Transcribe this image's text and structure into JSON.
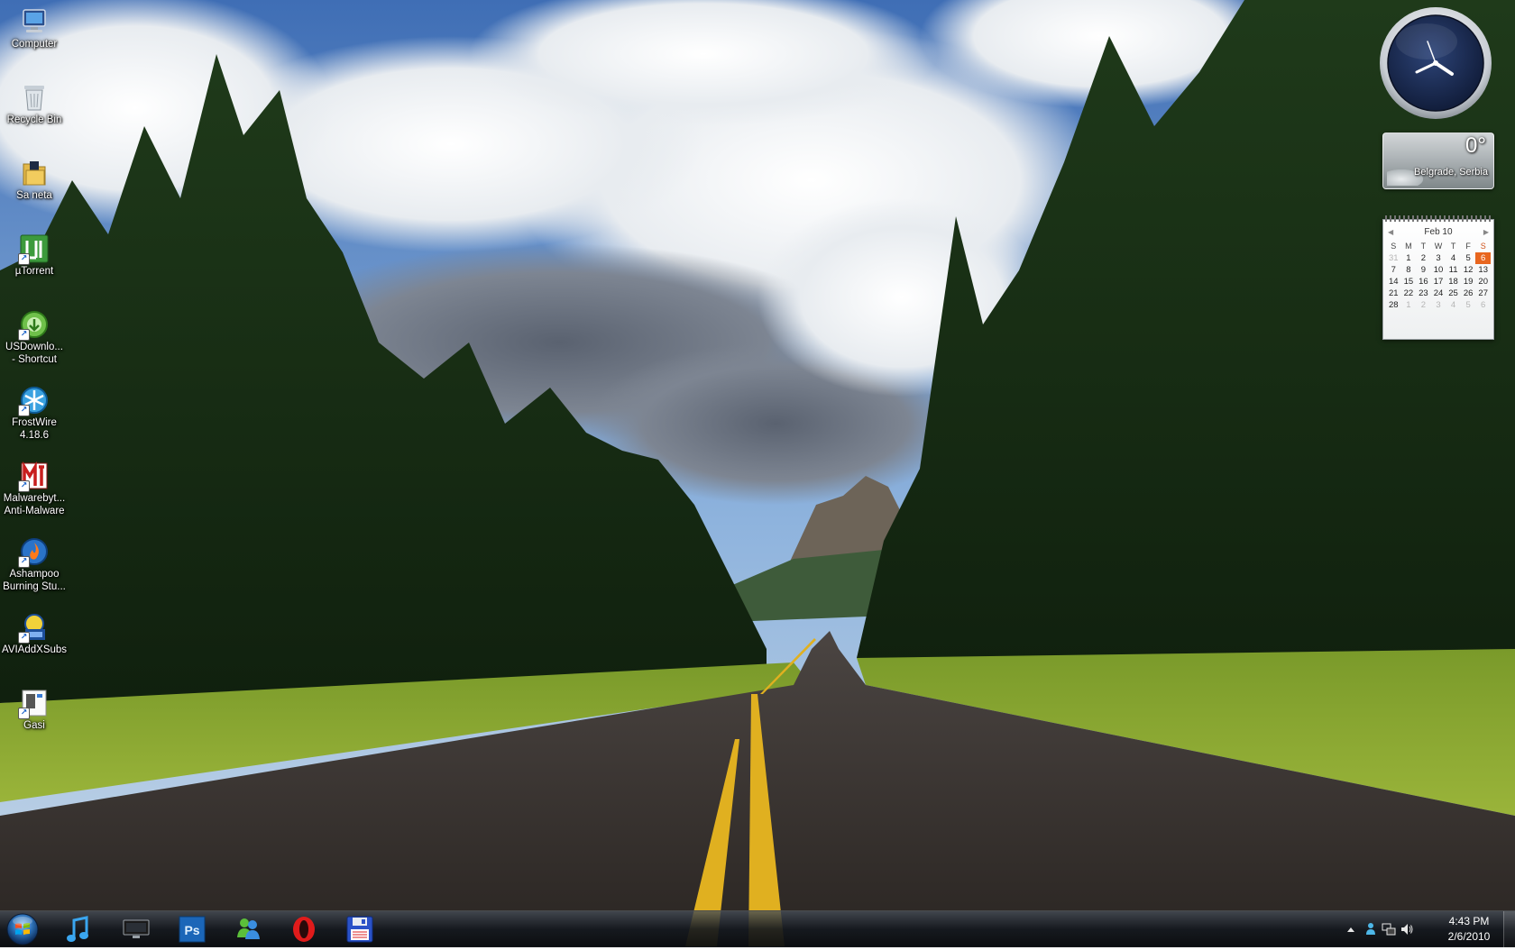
{
  "desktop": {
    "icons": [
      {
        "label": "Computer",
        "icon": "computer-icon"
      },
      {
        "label": "Recycle Bin",
        "icon": "recycle-bin-icon"
      },
      {
        "label": "Sa neta",
        "icon": "folder-icon"
      },
      {
        "label": "µTorrent",
        "icon": "utorrent-icon"
      },
      {
        "label": "USDownlo...\n- Shortcut",
        "icon": "usdownloader-icon"
      },
      {
        "label": "FrostWire\n4.18.6",
        "icon": "frostwire-icon"
      },
      {
        "label": "Malwarebyt...\nAnti-Malware",
        "icon": "malwarebytes-icon"
      },
      {
        "label": "Ashampoo\nBurning Stu...",
        "icon": "ashampoo-icon"
      },
      {
        "label": "AVIAddXSubs",
        "icon": "aviaddxsubs-icon"
      },
      {
        "label": "Gasi",
        "icon": "shutdown-shortcut-icon"
      }
    ]
  },
  "gadgets": {
    "clock": {
      "time": "4:43"
    },
    "weather": {
      "temperature": "0°",
      "location": "Belgrade, Serbia"
    },
    "calendar": {
      "month": "Feb 10",
      "weekdays": [
        "S",
        "M",
        "T",
        "W",
        "T",
        "F",
        "S"
      ],
      "days": [
        "31",
        "1",
        "2",
        "3",
        "4",
        "5",
        "6",
        "7",
        "8",
        "9",
        "10",
        "11",
        "12",
        "13",
        "14",
        "15",
        "16",
        "17",
        "18",
        "19",
        "20",
        "21",
        "22",
        "23",
        "24",
        "25",
        "26",
        "27",
        "28",
        "1",
        "2",
        "3",
        "4",
        "5",
        "6"
      ],
      "today": "6"
    }
  },
  "taskbar": {
    "start_button": "Start",
    "pinned": [
      {
        "name": "media-player-icon"
      },
      {
        "name": "monitor-icon"
      },
      {
        "name": "photoshop-icon",
        "label": "Ps"
      },
      {
        "name": "messenger-icon"
      },
      {
        "name": "opera-icon"
      },
      {
        "name": "save-disk-icon"
      }
    ],
    "tray": {
      "time": "4:43 PM",
      "date": "2/6/2010"
    }
  },
  "colors": {
    "taskbar": "#14181e",
    "calendar_today": "#e8661f",
    "clock_face": "#1c2c52"
  }
}
